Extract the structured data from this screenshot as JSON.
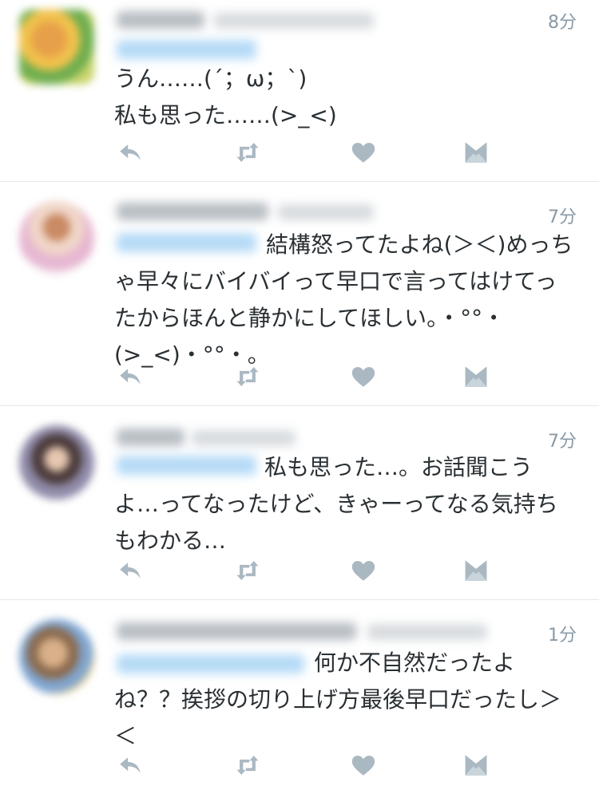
{
  "tweets": [
    {
      "time": "8分",
      "text": "うん……(´；ω；`)\n私も思った……(>_<)"
    },
    {
      "time": "7分",
      "text": "結構怒ってたよね(＞＜)めっちゃ早々にバイバイって早口で言ってはけてったからほんと静かにしてほしい。・°°・(>_<)・°°・。"
    },
    {
      "time": "7分",
      "text": "私も思った…。お話聞こうよ…ってなったけど、きゃーってなる気持ちもわかる…"
    },
    {
      "time": "1分",
      "text": "何か不自然だったよね？？挨拶の切り上げ方最後早口だったし＞＜"
    }
  ],
  "icons": {
    "reply": "reply-icon",
    "retweet": "retweet-icon",
    "like": "heart-icon",
    "dm": "envelope-icon"
  },
  "colors": {
    "icon": "#aab8c2",
    "muted": "#8899a6",
    "divider": "#e1e8ed",
    "mention": "#4aa3ee"
  }
}
